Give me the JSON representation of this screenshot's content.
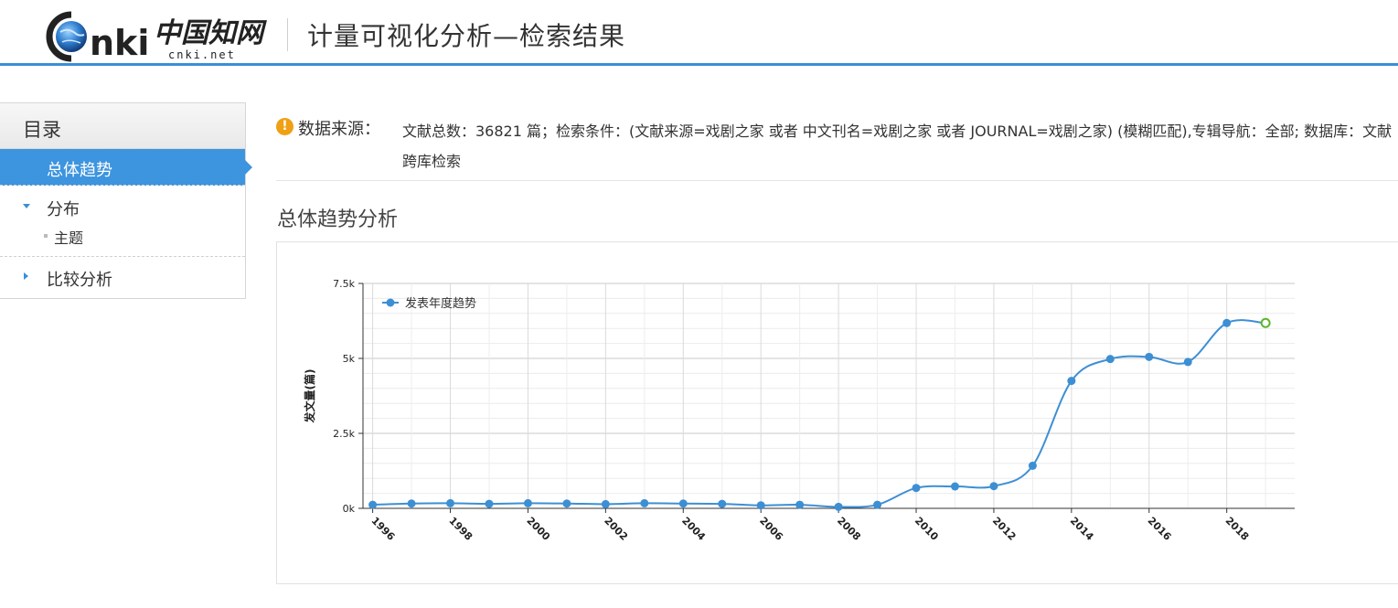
{
  "header": {
    "logo_text": "cnki",
    "logo_cn": "中国知网",
    "logo_sub": "cnki.net",
    "title": "计量可视化分析—检索结果"
  },
  "sidebar": {
    "heading": "目录",
    "items": [
      {
        "label": "总体趋势",
        "active": true
      },
      {
        "label": "分布",
        "expanded": true,
        "children": [
          {
            "label": "主题"
          }
        ]
      },
      {
        "label": "比较分析",
        "expanded": false
      }
    ]
  },
  "data_source": {
    "icon": "warning-icon",
    "label": "数据来源：",
    "text": "文献总数：36821 篇；检索条件：(文献来源=戏剧之家 或者 中文刊名=戏剧之家 或者 JOURNAL=戏剧之家) (模糊匹配),专辑导航：全部; 数据库：文献 跨库检索"
  },
  "section_title": "总体趋势分析",
  "colors": {
    "accent": "#3a8fd6",
    "series": "#3d8fd4",
    "forecast_marker": "#5bb62f",
    "warning": "#f0a014"
  },
  "chart_data": {
    "type": "line",
    "ylabel": "发文量(篇)",
    "xlabel": "",
    "legend": [
      "发表年度趋势"
    ],
    "legend_position": "top-left",
    "grid": true,
    "ylim": [
      0,
      7500
    ],
    "y_ticks": [
      "0k",
      "2.5k",
      "5k",
      "7.5k"
    ],
    "x_ticks": [
      "1996",
      "1998",
      "2000",
      "2002",
      "2004",
      "2006",
      "2008",
      "2010",
      "2012",
      "2014",
      "2016",
      "2018"
    ],
    "series": [
      {
        "name": "发表年度趋势",
        "x": [
          1996,
          1997,
          1998,
          1999,
          2000,
          2001,
          2002,
          2003,
          2004,
          2005,
          2006,
          2007,
          2008,
          2009,
          2010,
          2011,
          2012,
          2013,
          2014,
          2015,
          2016,
          2017,
          2018,
          2019
        ],
        "values": [
          120,
          160,
          170,
          150,
          170,
          160,
          140,
          170,
          160,
          150,
          100,
          120,
          50,
          120,
          680,
          730,
          740,
          1420,
          4250,
          4980,
          5050,
          4880,
          6180,
          6180
        ],
        "forecast_last": true
      }
    ]
  }
}
